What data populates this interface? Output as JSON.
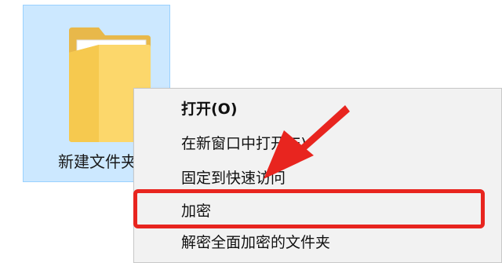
{
  "desktop": {
    "folder": {
      "label": "新建文件夹",
      "icon": "folder-icon",
      "selected": true
    }
  },
  "context_menu": {
    "items": [
      {
        "label": "打开(O)",
        "bold": true
      },
      {
        "label": "在新窗口中打开(E)",
        "bold": false
      },
      {
        "label": "固定到快速访问",
        "bold": false
      },
      {
        "label": "加密",
        "bold": false,
        "highlighted": true
      },
      {
        "label": "解密全面加密的文件夹",
        "bold": false
      }
    ]
  },
  "annotation": {
    "highlight_color": "#e8251f",
    "arrow_color": "#e8251f"
  },
  "colors": {
    "selection_fill": "#cce8ff",
    "selection_border": "#99d1ff",
    "menu_background": "#f2f2f2"
  }
}
